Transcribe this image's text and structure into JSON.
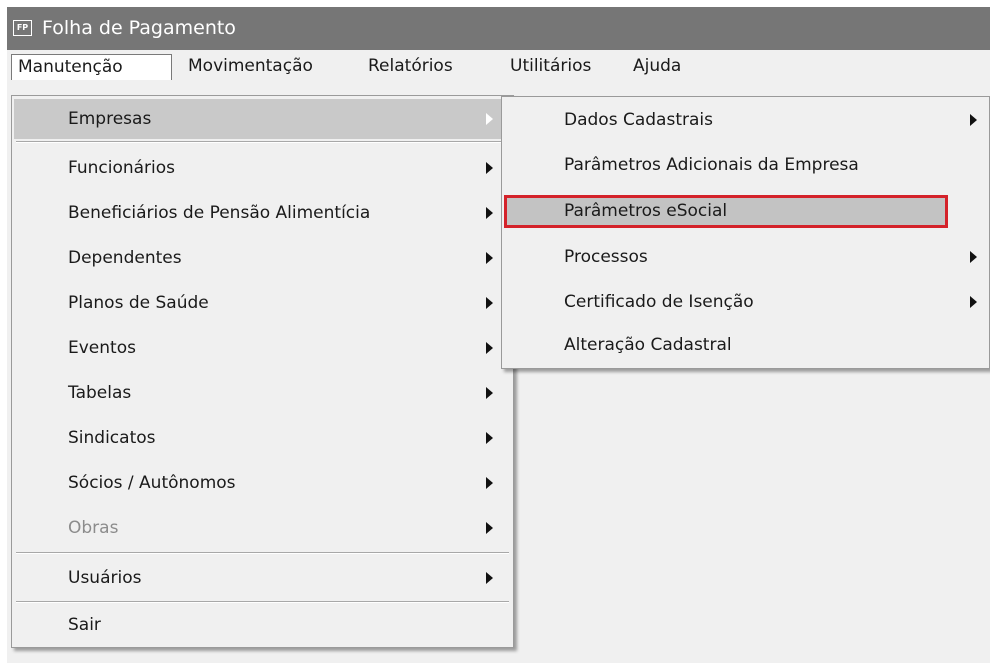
{
  "window": {
    "title": "Folha de Pagamento",
    "icon_text": "FP"
  },
  "menubar": [
    "Manutenção",
    "Movimentação",
    "Relatórios",
    "Utilitários",
    "Ajuda"
  ],
  "main_menu": {
    "items": [
      {
        "label": "Empresas",
        "submenu": true,
        "highlighted": true
      },
      {
        "label": "Funcionários",
        "submenu": true
      },
      {
        "label": "Beneficiários de Pensão Alimentícia",
        "submenu": true
      },
      {
        "label": "Dependentes",
        "submenu": true
      },
      {
        "label": "Planos de Saúde",
        "submenu": true
      },
      {
        "label": "Eventos",
        "submenu": true
      },
      {
        "label": "Tabelas",
        "submenu": true
      },
      {
        "label": "Sindicatos",
        "submenu": true
      },
      {
        "label": "Sócios / Autônomos",
        "submenu": true
      },
      {
        "label": "Obras",
        "submenu": true,
        "disabled": true
      },
      {
        "label": "Usuários",
        "submenu": true
      },
      {
        "label": "Sair",
        "submenu": false
      }
    ]
  },
  "submenu_empresas": {
    "items": [
      {
        "label": "Dados Cadastrais",
        "submenu": true
      },
      {
        "label": "Parâmetros Adicionais da Empresa",
        "submenu": false
      },
      {
        "label": "Parâmetros eSocial",
        "submenu": false,
        "selected": true
      },
      {
        "label": "Processos",
        "submenu": true
      },
      {
        "label": "Certificado de Isenção",
        "submenu": true
      },
      {
        "label": "Alteração Cadastral",
        "submenu": false
      }
    ]
  },
  "colors": {
    "titlebar": "#767676",
    "menu_background": "#f0f0f0",
    "highlight": "#c9c9c9",
    "selection_outline": "#d4222a"
  },
  "icons": [
    "app-icon",
    "submenu-arrow-icon"
  ]
}
